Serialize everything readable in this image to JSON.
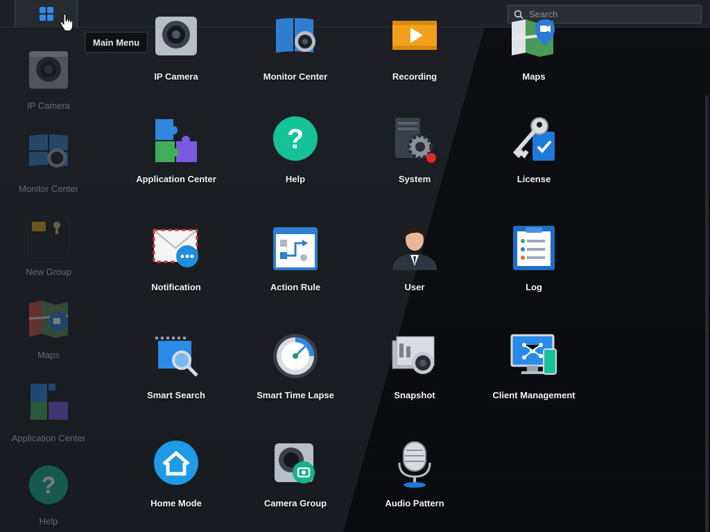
{
  "taskbar": {
    "main_menu_tooltip": "Main Menu",
    "search_placeholder": "Search"
  },
  "desktop": [
    {
      "label": "IP Camera",
      "icon": "ip-camera-icon"
    },
    {
      "label": "Monitor Center",
      "icon": "monitor-center-icon"
    },
    {
      "label": "New Group",
      "icon": "folder-group-icon"
    },
    {
      "label": "Maps",
      "icon": "maps-icon"
    },
    {
      "label": "Application Center",
      "icon": "puzzle-icon"
    },
    {
      "label": "Help",
      "icon": "help-icon"
    }
  ],
  "apps": [
    {
      "label": "IP Camera",
      "icon": "ip-camera-icon"
    },
    {
      "label": "Monitor Center",
      "icon": "monitor-center-icon"
    },
    {
      "label": "Recording",
      "icon": "recording-icon"
    },
    {
      "label": "Maps",
      "icon": "maps-icon"
    },
    {
      "label": "Application Center",
      "icon": "puzzle-icon"
    },
    {
      "label": "Help",
      "icon": "help-icon"
    },
    {
      "label": "System",
      "icon": "system-icon"
    },
    {
      "label": "License",
      "icon": "license-key-icon"
    },
    {
      "label": "Notification",
      "icon": "notification-icon"
    },
    {
      "label": "Action Rule",
      "icon": "action-rule-icon"
    },
    {
      "label": "User",
      "icon": "user-icon"
    },
    {
      "label": "Log",
      "icon": "log-icon"
    },
    {
      "label": "Smart Search",
      "icon": "smart-search-icon"
    },
    {
      "label": "Smart Time Lapse",
      "icon": "time-lapse-icon"
    },
    {
      "label": "Snapshot",
      "icon": "snapshot-icon"
    },
    {
      "label": "Client Management",
      "icon": "client-management-icon"
    },
    {
      "label": "Home Mode",
      "icon": "home-mode-icon"
    },
    {
      "label": "Camera Group",
      "icon": "camera-group-icon"
    },
    {
      "label": "Audio Pattern",
      "icon": "microphone-icon"
    }
  ]
}
